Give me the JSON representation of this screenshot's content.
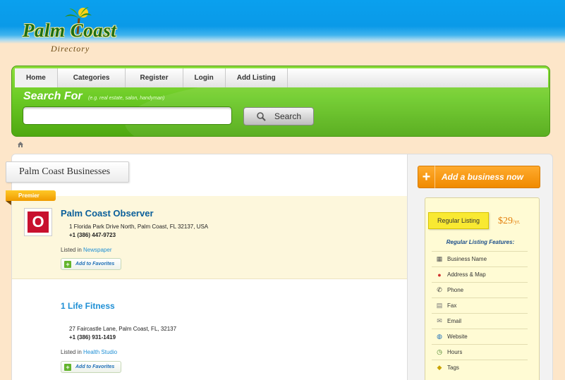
{
  "logo": {
    "name": "Palm Coast",
    "sub": "Directory"
  },
  "nav": {
    "items": [
      "Home",
      "Categories",
      "Register",
      "Login",
      "Add Listing"
    ]
  },
  "search": {
    "label": "Search For",
    "hint": "(e.g. real estate, salon, handyman)",
    "value": "",
    "placeholder": "",
    "button": "Search"
  },
  "section": {
    "title": "Palm Coast Businesses",
    "premier_tag": "Premier"
  },
  "listings": [
    {
      "name": "Palm Coast Observer",
      "address": "1 Florida Park Drive North, Palm Coast, FL 32137, USA",
      "phone": "+1 (386) 447-9723",
      "listed_prefix": "Listed in",
      "category": "Newspaper",
      "favorites": "Add to Favorites",
      "logo_letter": "O"
    },
    {
      "name": "1 Life Fitness",
      "address": "27 Faircastle Lane, Palm Coast, FL, 32137",
      "phone": "+1 (386) 931-1419",
      "listed_prefix": "Listed in",
      "category": "Health Studio",
      "favorites": "Add to Favorites"
    }
  ],
  "sidebar": {
    "add_business": "Add a business now",
    "plan": "Regular Listing",
    "price": "$29",
    "price_unit": "/yr.",
    "features_title": "Regular Listing Features:",
    "features": [
      {
        "label": "Business Name",
        "icon": "building-icon"
      },
      {
        "label": "Address & Map",
        "icon": "map-pin-icon"
      },
      {
        "label": "Phone",
        "icon": "phone-icon"
      },
      {
        "label": "Fax",
        "icon": "fax-icon"
      },
      {
        "label": "Email",
        "icon": "email-icon"
      },
      {
        "label": "Website",
        "icon": "globe-icon"
      },
      {
        "label": "Hours",
        "icon": "clock-icon"
      },
      {
        "label": "Tags",
        "icon": "tag-icon"
      }
    ]
  },
  "colors": {
    "accent_green": "#6ccb26",
    "link_blue": "#0a5f9a",
    "orange": "#f08a00"
  }
}
